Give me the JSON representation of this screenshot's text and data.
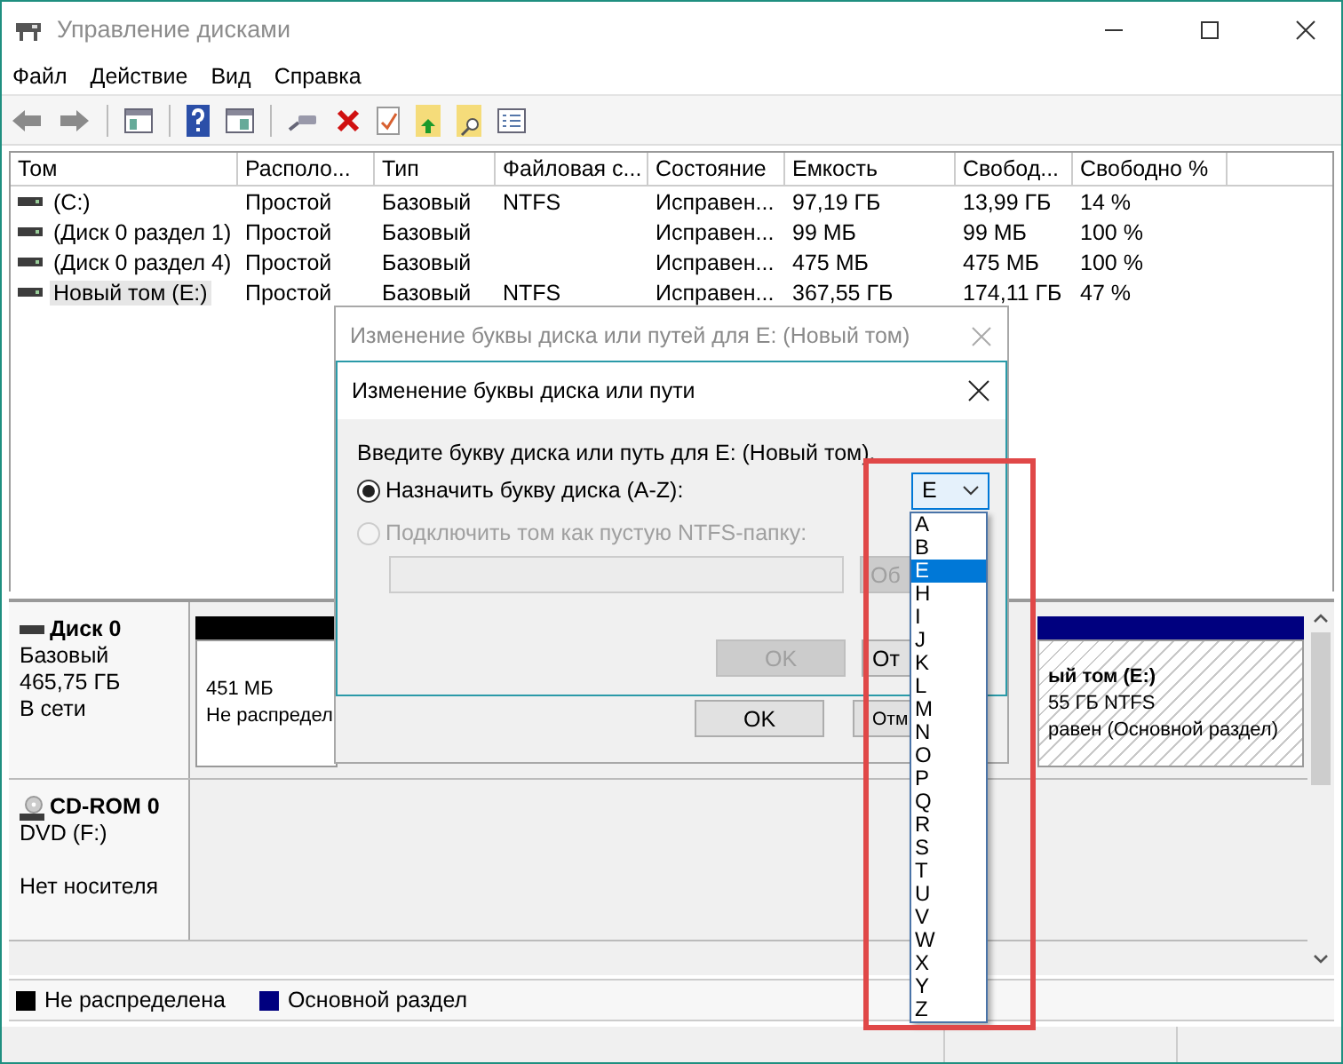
{
  "window": {
    "title": "Управление дисками"
  },
  "menu": [
    "Файл",
    "Действие",
    "Вид",
    "Справка"
  ],
  "volumes": {
    "columns": [
      "Том",
      "Располо...",
      "Тип",
      "Файловая с...",
      "Состояние",
      "Емкость",
      "Свобод...",
      "Свободно %"
    ],
    "rows": [
      {
        "selected": false,
        "cells": [
          "(C:)",
          "Простой",
          "Базовый",
          "NTFS",
          "Исправен...",
          "97,19 ГБ",
          "13,99 ГБ",
          "14 %"
        ]
      },
      {
        "selected": false,
        "cells": [
          "(Диск 0 раздел 1)",
          "Простой",
          "Базовый",
          "",
          "Исправен...",
          "99 МБ",
          "99 МБ",
          "100 %"
        ]
      },
      {
        "selected": false,
        "cells": [
          "(Диск 0 раздел 4)",
          "Простой",
          "Базовый",
          "",
          "Исправен...",
          "475 МБ",
          "475 МБ",
          "100 %"
        ]
      },
      {
        "selected": true,
        "cells": [
          "Новый том (E:)",
          "Простой",
          "Базовый",
          "NTFS",
          "Исправен...",
          "367,55 ГБ",
          "174,11 ГБ",
          "47 %"
        ]
      }
    ]
  },
  "disks": [
    {
      "kind": "disk",
      "name": "Диск 0",
      "type": "Базовый",
      "size": "465,75 ГБ",
      "status": "В сети",
      "partitions": [
        {
          "kind": "unallocated",
          "selected": false,
          "size": "451 МБ",
          "label": "Не распредел"
        },
        {
          "kind": "primary",
          "selected": true,
          "name": "ый том  (E:)",
          "size": "55 ГБ NTFS",
          "label": "равен (Основной раздел)"
        }
      ]
    },
    {
      "kind": "cdrom",
      "name": "CD-ROM 0",
      "type": "DVD (F:)",
      "status": "Нет носителя"
    }
  ],
  "legend": [
    {
      "label": "Не распределена",
      "color": "#000000"
    },
    {
      "label": "Основной раздел",
      "color": "#00007f"
    }
  ],
  "back_dialog": {
    "title": "Изменение буквы диска или путей для E: (Новый том)",
    "buttons": [
      {
        "label": "OK",
        "disabled": false
      },
      {
        "label": "Отм",
        "disabled": false
      }
    ]
  },
  "dialog": {
    "title": "Изменение буквы диска или пути",
    "prompt": "Введите букву диска или путь для E: (Новый том).",
    "options": [
      {
        "label": "Назначить букву диска (A-Z):",
        "selected": true,
        "disabled": false
      },
      {
        "label": "Подключить том как пустую NTFS-папку:",
        "selected": false,
        "disabled": true
      }
    ],
    "path_field": {
      "disabled": true
    },
    "browse_button": {
      "label": "Об",
      "disabled": true
    },
    "buttons": [
      {
        "label": "OK",
        "disabled": true
      },
      {
        "label": "От",
        "disabled": false
      }
    ],
    "letter": {
      "value": "E",
      "expanded": true,
      "options": [
        {
          "label": "A",
          "selected": false
        },
        {
          "label": "B",
          "selected": false
        },
        {
          "label": "E",
          "selected": true
        },
        {
          "label": "H",
          "selected": false
        },
        {
          "label": "I",
          "selected": false
        },
        {
          "label": "J",
          "selected": false
        },
        {
          "label": "K",
          "selected": false
        },
        {
          "label": "L",
          "selected": false
        },
        {
          "label": "M",
          "selected": false
        },
        {
          "label": "N",
          "selected": false
        },
        {
          "label": "O",
          "selected": false
        },
        {
          "label": "P",
          "selected": false
        },
        {
          "label": "Q",
          "selected": false
        },
        {
          "label": "R",
          "selected": false
        },
        {
          "label": "S",
          "selected": false
        },
        {
          "label": "T",
          "selected": false
        },
        {
          "label": "U",
          "selected": false
        },
        {
          "label": "V",
          "selected": false
        },
        {
          "label": "W",
          "selected": false
        },
        {
          "label": "X",
          "selected": false
        },
        {
          "label": "Y",
          "selected": false
        },
        {
          "label": "Z",
          "selected": false
        }
      ]
    }
  }
}
